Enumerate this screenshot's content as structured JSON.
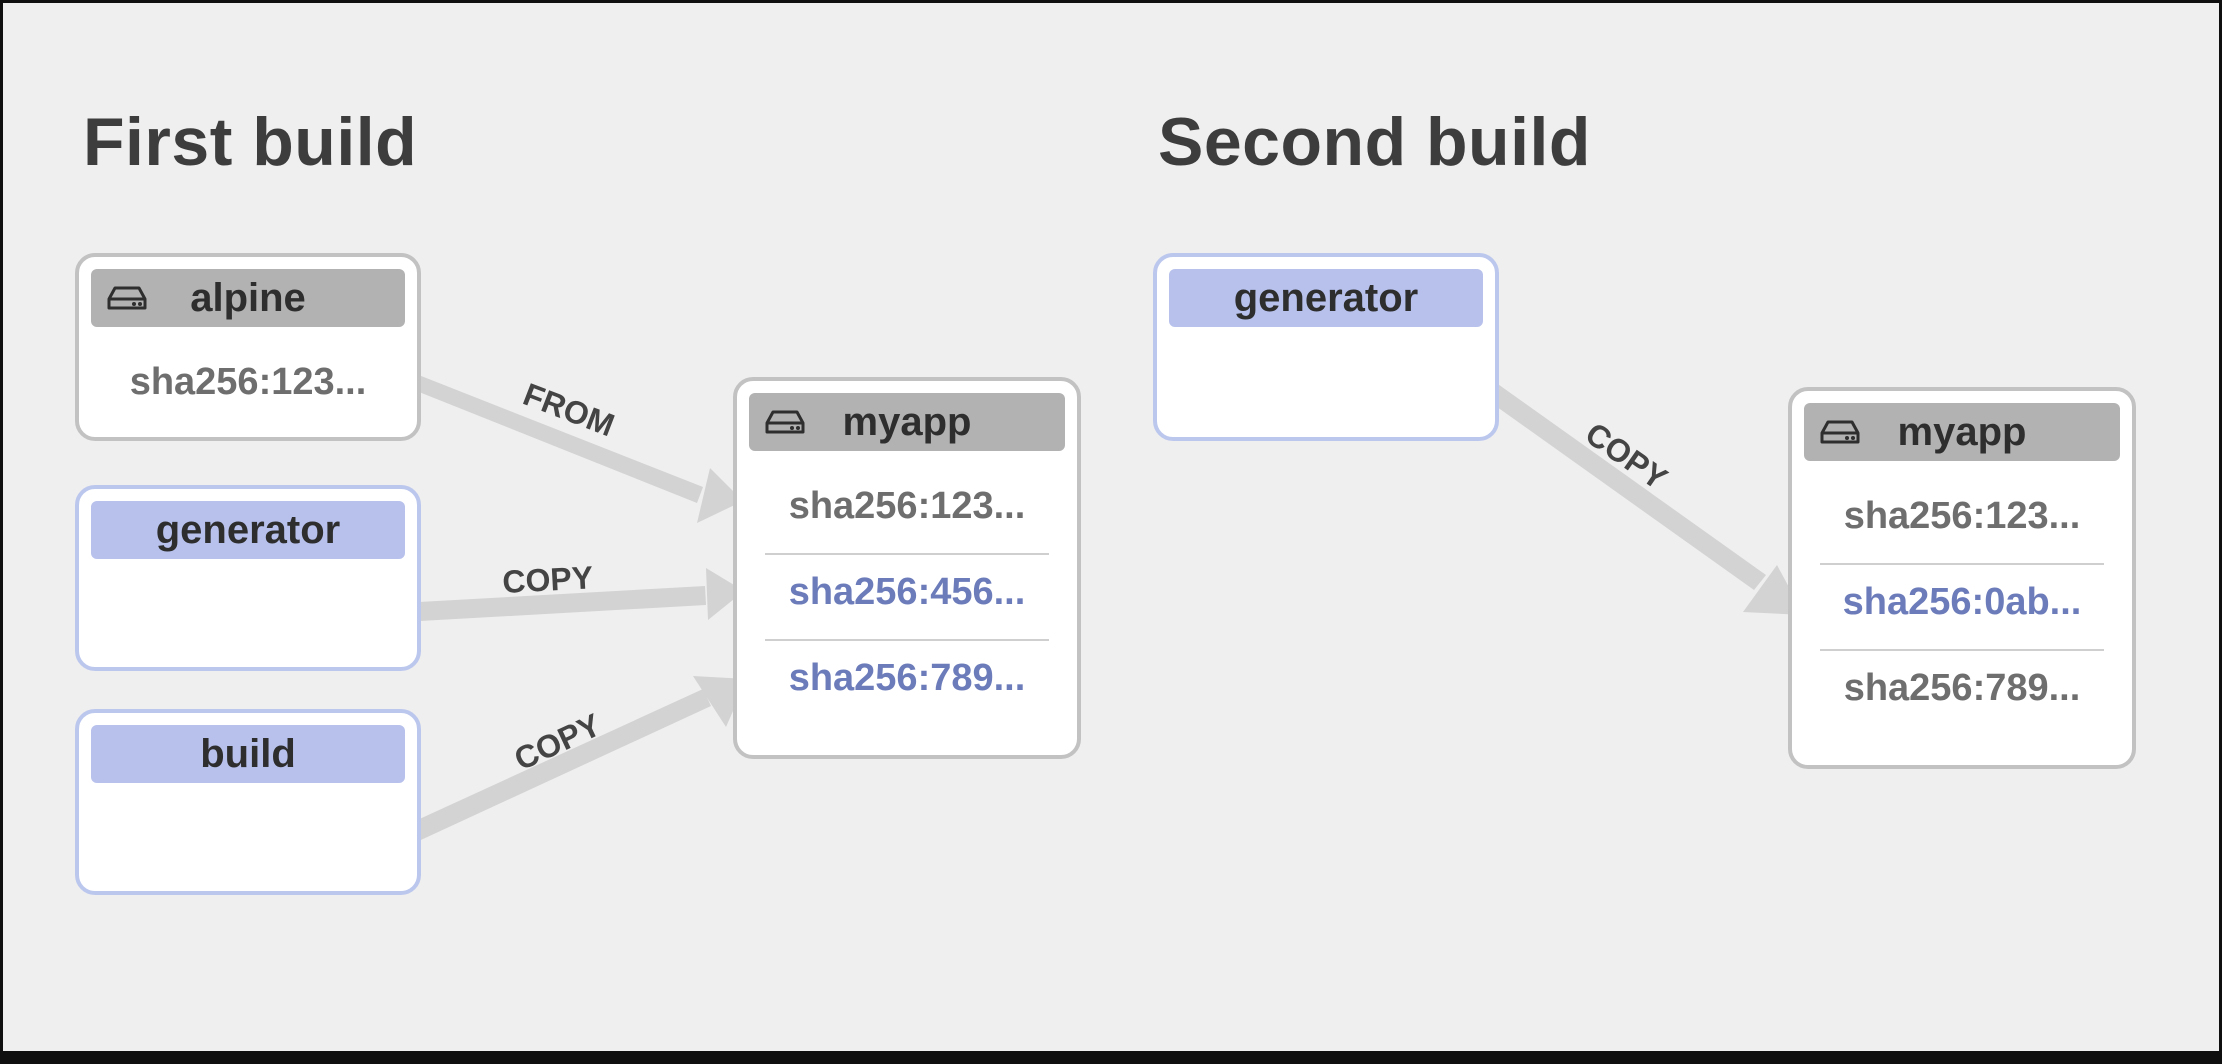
{
  "first_build": {
    "title": "First build",
    "alpine": {
      "name": "alpine",
      "layers": [
        "sha256:123..."
      ]
    },
    "generator": {
      "name": "generator"
    },
    "build": {
      "name": "build"
    },
    "myapp": {
      "name": "myapp",
      "layers": [
        "sha256:123...",
        "sha256:456...",
        "sha256:789..."
      ]
    },
    "arrows": {
      "from": "FROM",
      "copy1": "COPY",
      "copy2": "COPY"
    }
  },
  "second_build": {
    "title": "Second build",
    "generator": {
      "name": "generator"
    },
    "myapp": {
      "name": "myapp",
      "layers": [
        "sha256:123...",
        "sha256:0ab...",
        "sha256:789..."
      ]
    },
    "arrows": {
      "copy": "COPY"
    }
  },
  "colors": {
    "image_header": "#b2b2b2",
    "stage_header": "#b7c1ec",
    "changed_layer": "#6c7cba",
    "unchanged_layer": "#6e6e6e"
  },
  "icons": {
    "image": "hard-drive-icon"
  }
}
